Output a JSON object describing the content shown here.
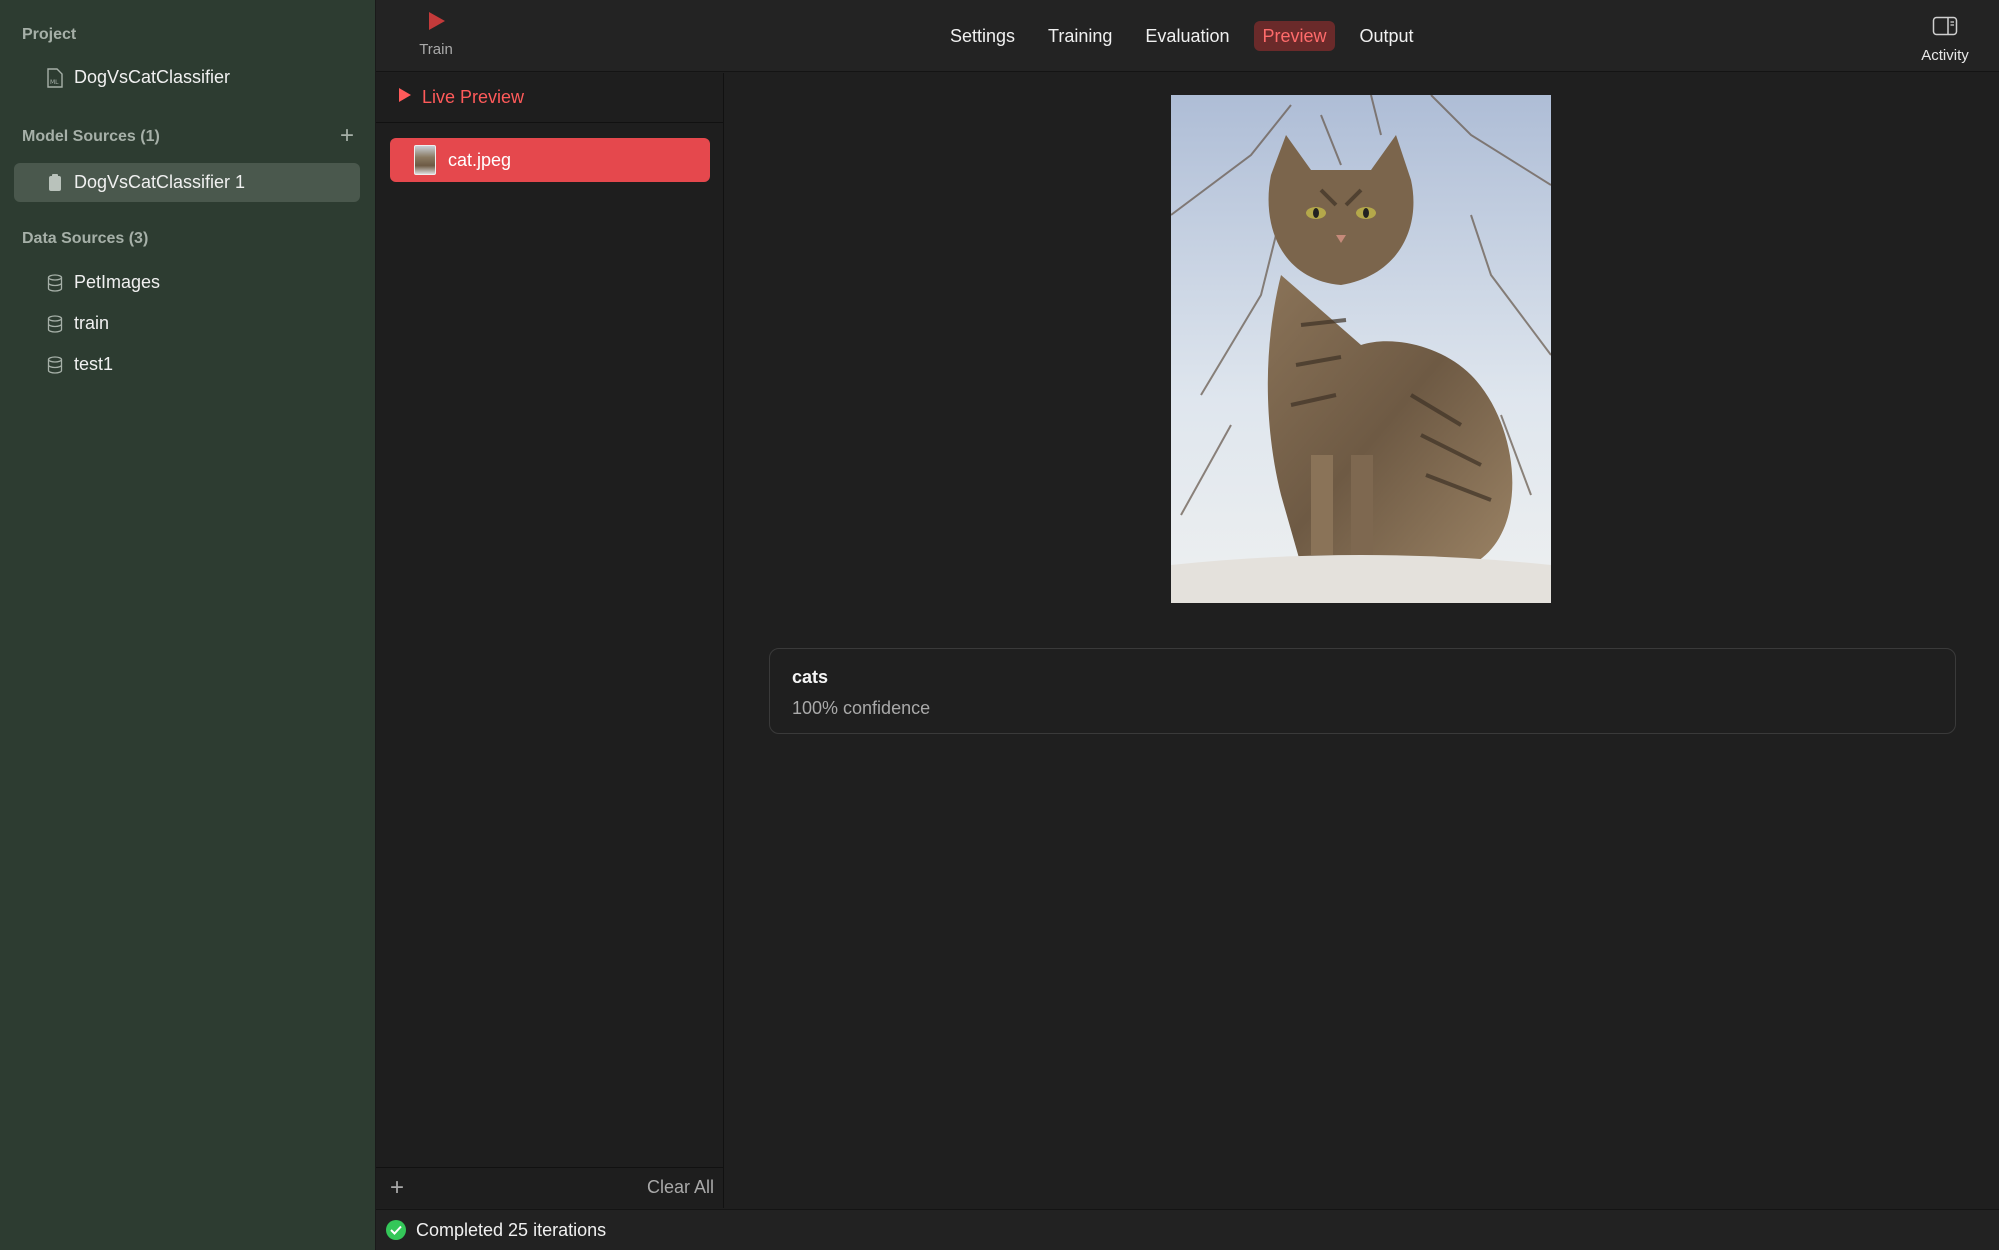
{
  "sidebar": {
    "project_title": "Project",
    "project_item": "DogVsCatClassifier",
    "model_sources_title": "Model Sources (1)",
    "model_item": "DogVsCatClassifier 1",
    "data_sources_title": "Data Sources (3)",
    "data_items": [
      "PetImages",
      "train",
      "test1"
    ]
  },
  "toolbar": {
    "train_label": "Train",
    "tabs": [
      "Settings",
      "Training",
      "Evaluation",
      "Preview",
      "Output"
    ],
    "active_tab": "Preview",
    "activity_label": "Activity"
  },
  "preview_list": {
    "header": "Live Preview",
    "files": [
      "cat.jpeg"
    ],
    "clear_label": "Clear All"
  },
  "result": {
    "label": "cats",
    "confidence": "100% confidence"
  },
  "status": {
    "text": "Completed 25 iterations"
  },
  "colors": {
    "accent": "#e5484d",
    "sidebar_bg": "#2d3c31",
    "success": "#34c759"
  }
}
